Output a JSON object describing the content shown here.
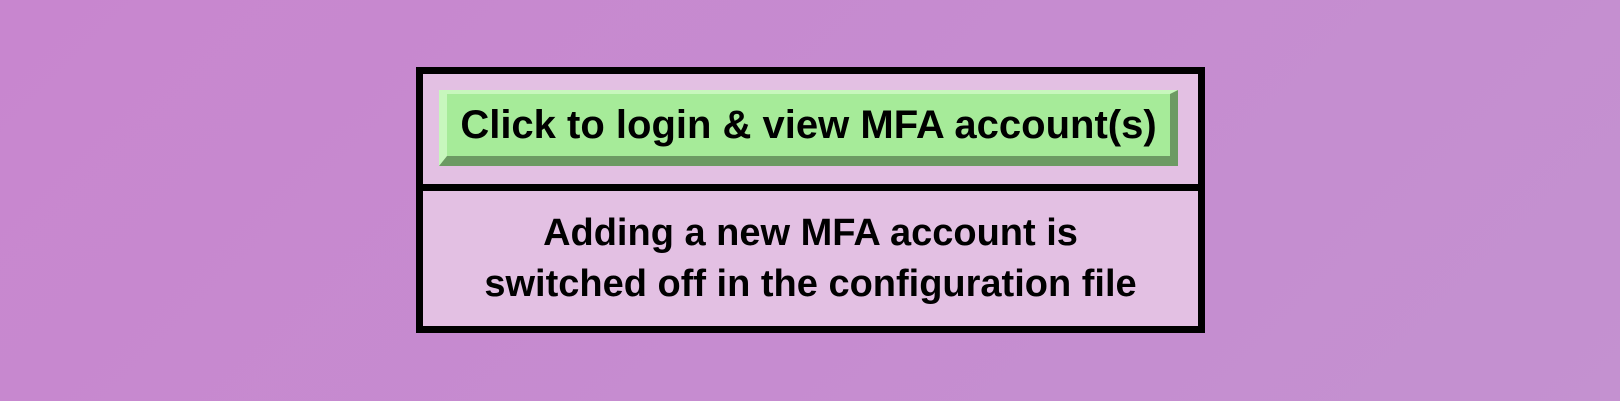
{
  "colors": {
    "background": "#c886cf",
    "panel": "#e3c0e3",
    "border": "#000000",
    "button": "#a6eb99",
    "button_shadow": "#6c9a63"
  },
  "login": {
    "button_label": "Click to login & view MFA account(s)"
  },
  "notice": {
    "line1": "Adding a new MFA account is",
    "line2": "switched off in the configuration file"
  }
}
